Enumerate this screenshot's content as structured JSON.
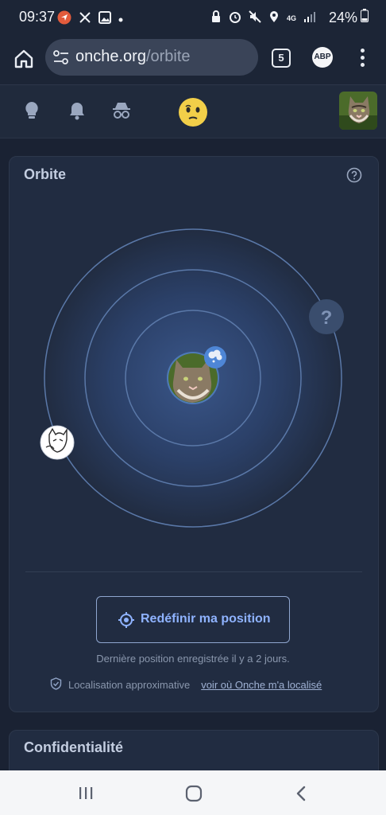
{
  "status_bar": {
    "time": "09:37",
    "battery": "24%",
    "network": "4G",
    "left_icons": [
      "navigation-icon",
      "crossed-tools-icon",
      "image-icon",
      "dot-icon"
    ],
    "right_icons": [
      "lock-icon",
      "alarm-icon",
      "mute-icon",
      "location-icon",
      "network-icon",
      "signal-icon"
    ]
  },
  "browser": {
    "url_domain": "onche.org",
    "url_path": "/orbite",
    "tab_count": "5",
    "abp_label": "ABP"
  },
  "site_nav": {
    "icons": [
      "lightbulb-icon",
      "bell-icon",
      "incognito-icon",
      "smiley-icon",
      "user-avatar"
    ]
  },
  "orbit_card": {
    "title": "Orbite",
    "unknown_marker": "?",
    "rings": 4,
    "redefine_button": "Redéfinir ma position",
    "last_position": "Dernière position enregistrée il y a 2 jours.",
    "localisation_label": "Localisation approximative",
    "localisation_link": "voir où Onche m'a localisé"
  },
  "privacy_card": {
    "title": "Confidentialité"
  },
  "android_nav": {
    "buttons": [
      "recents-button",
      "home-button",
      "back-button"
    ]
  },
  "colors": {
    "background": "#1a2233",
    "card": "#212c41",
    "accent": "#8fb3ff",
    "ring": "#5a78a8"
  }
}
